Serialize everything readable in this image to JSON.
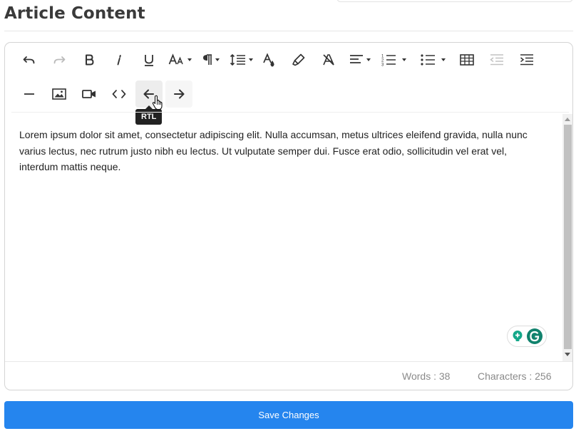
{
  "page": {
    "title": "Article Content"
  },
  "editor": {
    "toolbar": {
      "rows": [
        [
          "undo",
          "redo",
          "bold",
          "italic",
          "underline",
          "font-size",
          "paragraph-format",
          "line-height",
          "text-color",
          "highlight",
          "clear-formatting",
          "align",
          "ordered-list",
          "unordered-list",
          "insert-table",
          "outdent",
          "indent"
        ],
        [
          "horizontal-line",
          "insert-image",
          "insert-video",
          "code-view",
          "rtl",
          "ltr"
        ]
      ],
      "tooltip": "RTL"
    },
    "content": "Lorem ipsum dolor sit amet, consectetur adipiscing elit. Nulla accumsan, metus ultrices eleifend gravida, nulla nunc varius lectus, nec rutrum justo nibh eu lectus. Ut vulputate semper dui. Fusce erat odio, sollicitudin vel erat vel, interdum mattis neque.",
    "stats": {
      "words": "Words : 38",
      "characters": "Characters : 256"
    }
  },
  "actions": {
    "save_label": "Save Changes"
  },
  "colors": {
    "accent": "#2585ee",
    "grammarly": "#15c39a"
  }
}
